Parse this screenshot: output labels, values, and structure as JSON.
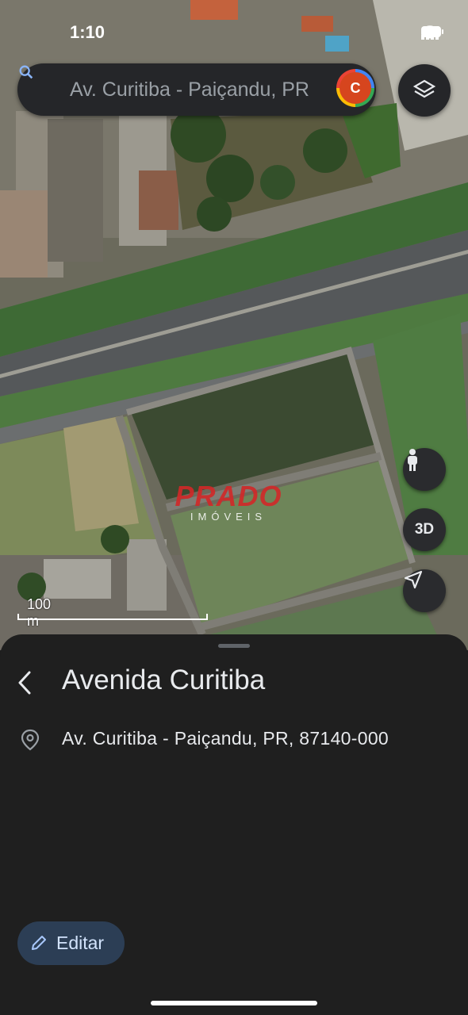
{
  "status_bar": {
    "time": "1:10"
  },
  "search": {
    "text": "Av. Curitiba - Paiçandu, PR",
    "avatar_letter": "C"
  },
  "map": {
    "scale_label": "100 m",
    "watermark": {
      "brand": "PRADO",
      "sub": "IMÓVEIS"
    },
    "buttons": {
      "view_3d": "3D"
    }
  },
  "place": {
    "title": "Avenida Curitiba",
    "address": "Av. Curitiba - Paiçandu, PR, 87140-000"
  },
  "actions": {
    "edit_label": "Editar"
  },
  "colors": {
    "accent_button_bg": "#2c3e55",
    "sheet_bg": "#1f1f1f",
    "search_bg": "#252629"
  }
}
